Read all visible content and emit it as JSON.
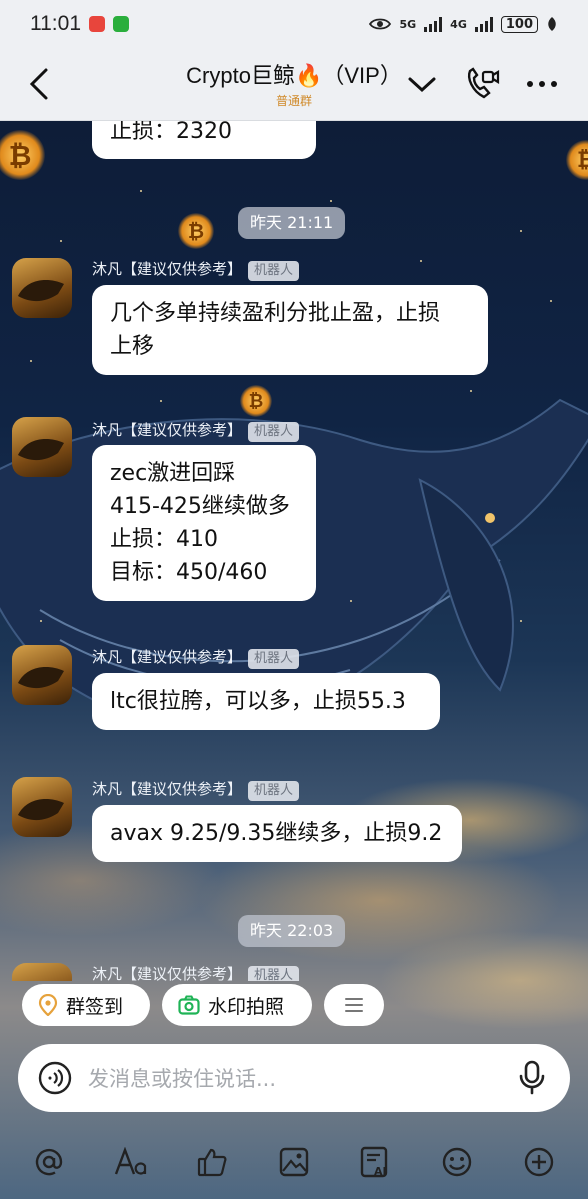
{
  "status_bar": {
    "time": "11:01",
    "network_1": "5G",
    "network_2": "4G",
    "battery": "100"
  },
  "header": {
    "title": "Crypto巨鲸🔥（VIP）",
    "subtitle": "普通群"
  },
  "messages": [
    {
      "text": "止损：2320"
    },
    {
      "timestamp": "昨天 21:11"
    },
    {
      "sender": "沐凡【建议仅供参考】",
      "tag": "机器人",
      "text": "几个多单持续盈利分批止盈，止损\n上移"
    },
    {
      "sender": "沐凡【建议仅供参考】",
      "tag": "机器人",
      "text": "zec激进回踩\n415-425继续做多\n止损：410\n目标：450/460"
    },
    {
      "sender": "沐凡【建议仅供参考】",
      "tag": "机器人",
      "text": "ltc很拉胯，可以多，止损55.3"
    },
    {
      "sender": "沐凡【建议仅供参考】",
      "tag": "机器人",
      "text": "avax 9.25/9.35继续多，止损9.2"
    },
    {
      "timestamp": "昨天 22:03"
    },
    {
      "sender": "沐凡【建议仅供参考】",
      "tag": "机器人"
    }
  ],
  "quick_actions": [
    {
      "label": "群签到",
      "icon": "location-pin-icon"
    },
    {
      "label": "水印拍照",
      "icon": "camera-icon"
    },
    {
      "label": "",
      "icon": "menu-icon"
    }
  ],
  "input": {
    "placeholder": "发消息或按住说话...",
    "value": ""
  },
  "toolbar": [
    "at-icon",
    "font-icon",
    "thumbs-up-icon",
    "image-icon",
    "ai-text-icon",
    "emoji-icon",
    "plus-icon"
  ],
  "colors": {
    "accent_green": "#1fb356",
    "accent_orange": "#e6a23c",
    "subtitle_color": "#d08a2a"
  }
}
